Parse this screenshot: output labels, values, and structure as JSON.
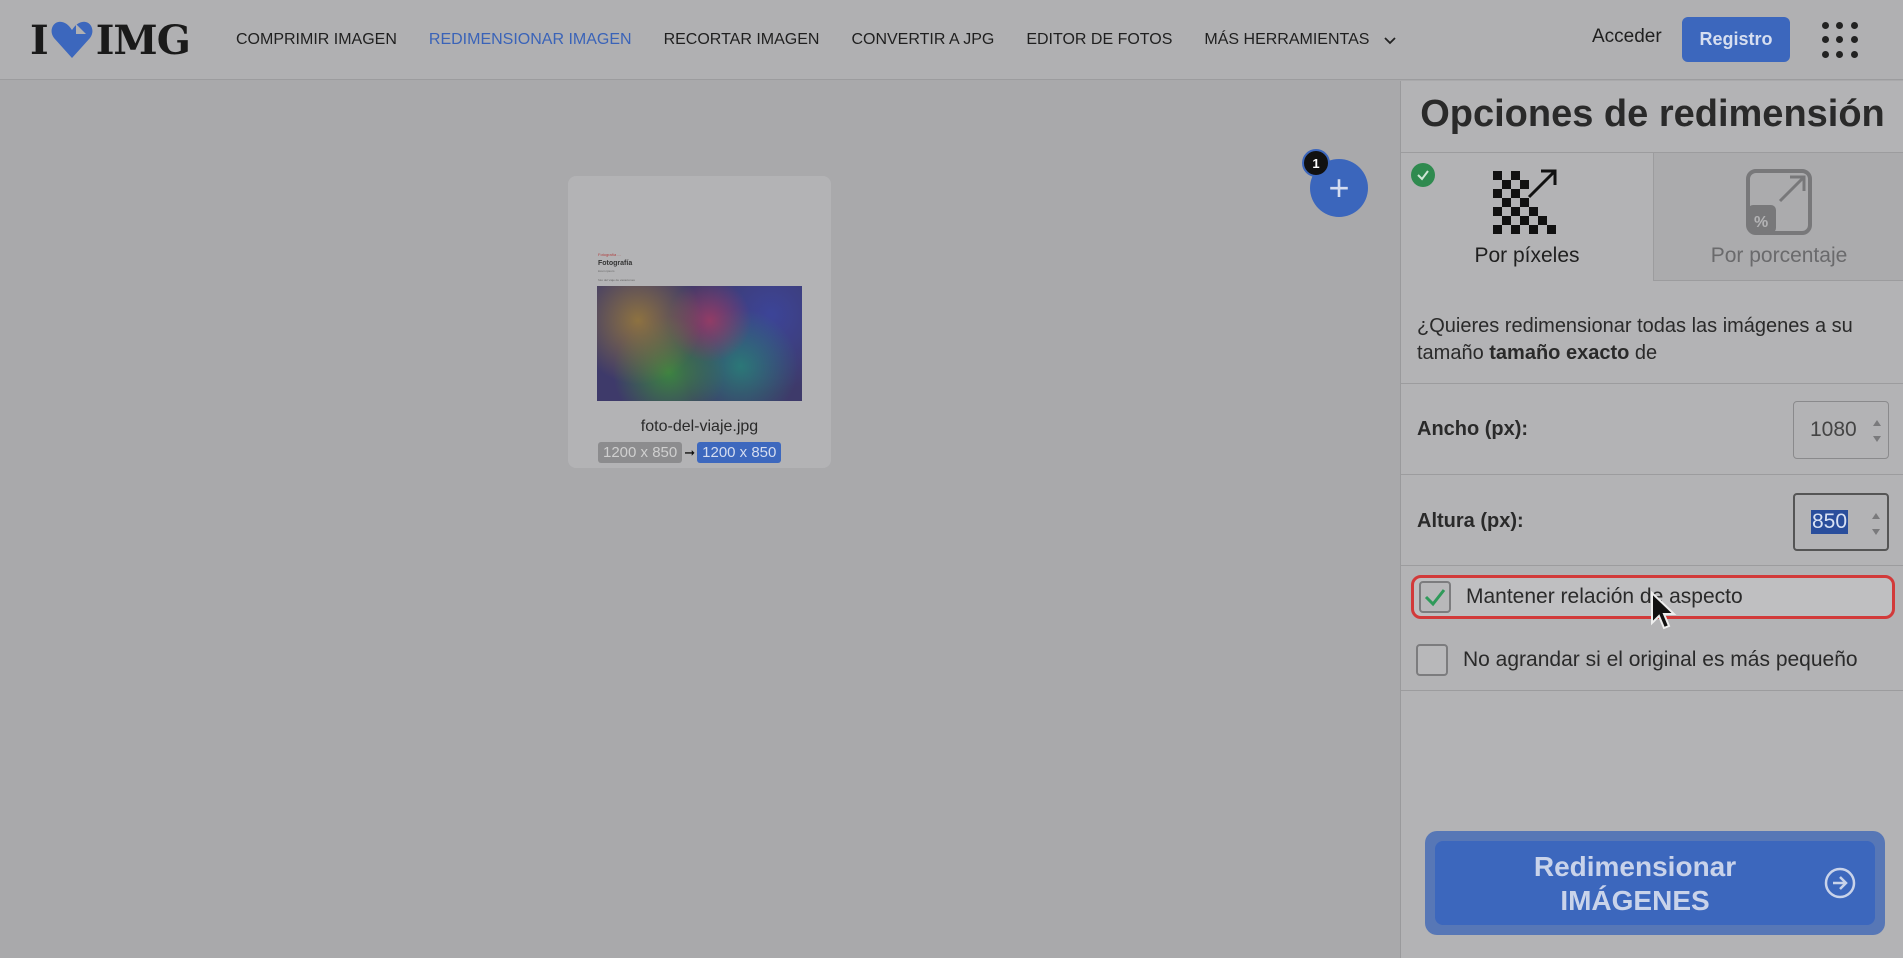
{
  "header": {
    "logo_left": "I",
    "logo_right": "IMG",
    "nav": [
      {
        "label": "COMPRIMIR IMAGEN",
        "active": false
      },
      {
        "label": "REDIMENSIONAR IMAGEN",
        "active": true
      },
      {
        "label": "RECORTAR IMAGEN",
        "active": false
      },
      {
        "label": "CONVERTIR A JPG",
        "active": false
      },
      {
        "label": "EDITOR DE FOTOS",
        "active": false
      },
      {
        "label": "MÁS HERRAMIENTAS",
        "active": false
      }
    ],
    "login": "Acceder",
    "register": "Registro"
  },
  "canvas": {
    "file": {
      "thumb_line1": "Fotografía ...",
      "thumb_title": "Fotografía",
      "thumb_line3": "lorem ipsum",
      "thumb_line4": "foto del viaje de vacaciones",
      "name": "foto-del-viaje.jpg",
      "original_size": "1200 x 850",
      "arrow": "➞",
      "new_size": "1200 x 850"
    },
    "add_button": "+",
    "file_count": "1"
  },
  "sidebar": {
    "title": "Opciones de redimensión",
    "tabs": [
      {
        "label": "Por píxeles",
        "selected": true
      },
      {
        "label": "Por porcentaje",
        "selected": false
      }
    ],
    "description_start": "¿Quieres redimensionar todas las imágenes a su tamaño ",
    "description_bold": "tamaño exacto",
    "description_end": " de",
    "width_label": "Ancho (px):",
    "width_value": "1080",
    "height_label": "Altura (px):",
    "height_value": "850",
    "keep_aspect_label": "Mantener relación de aspecto",
    "keep_aspect_checked": true,
    "no_enlarge_label": "No agrandar si el original es más pequeño",
    "no_enlarge_checked": false,
    "action_line1": "Redimensionar",
    "action_line2": "IMÁGENES"
  },
  "colors": {
    "accent": "#3c67bd",
    "check": "#2f8a4f",
    "highlight": "#d23a3a"
  }
}
